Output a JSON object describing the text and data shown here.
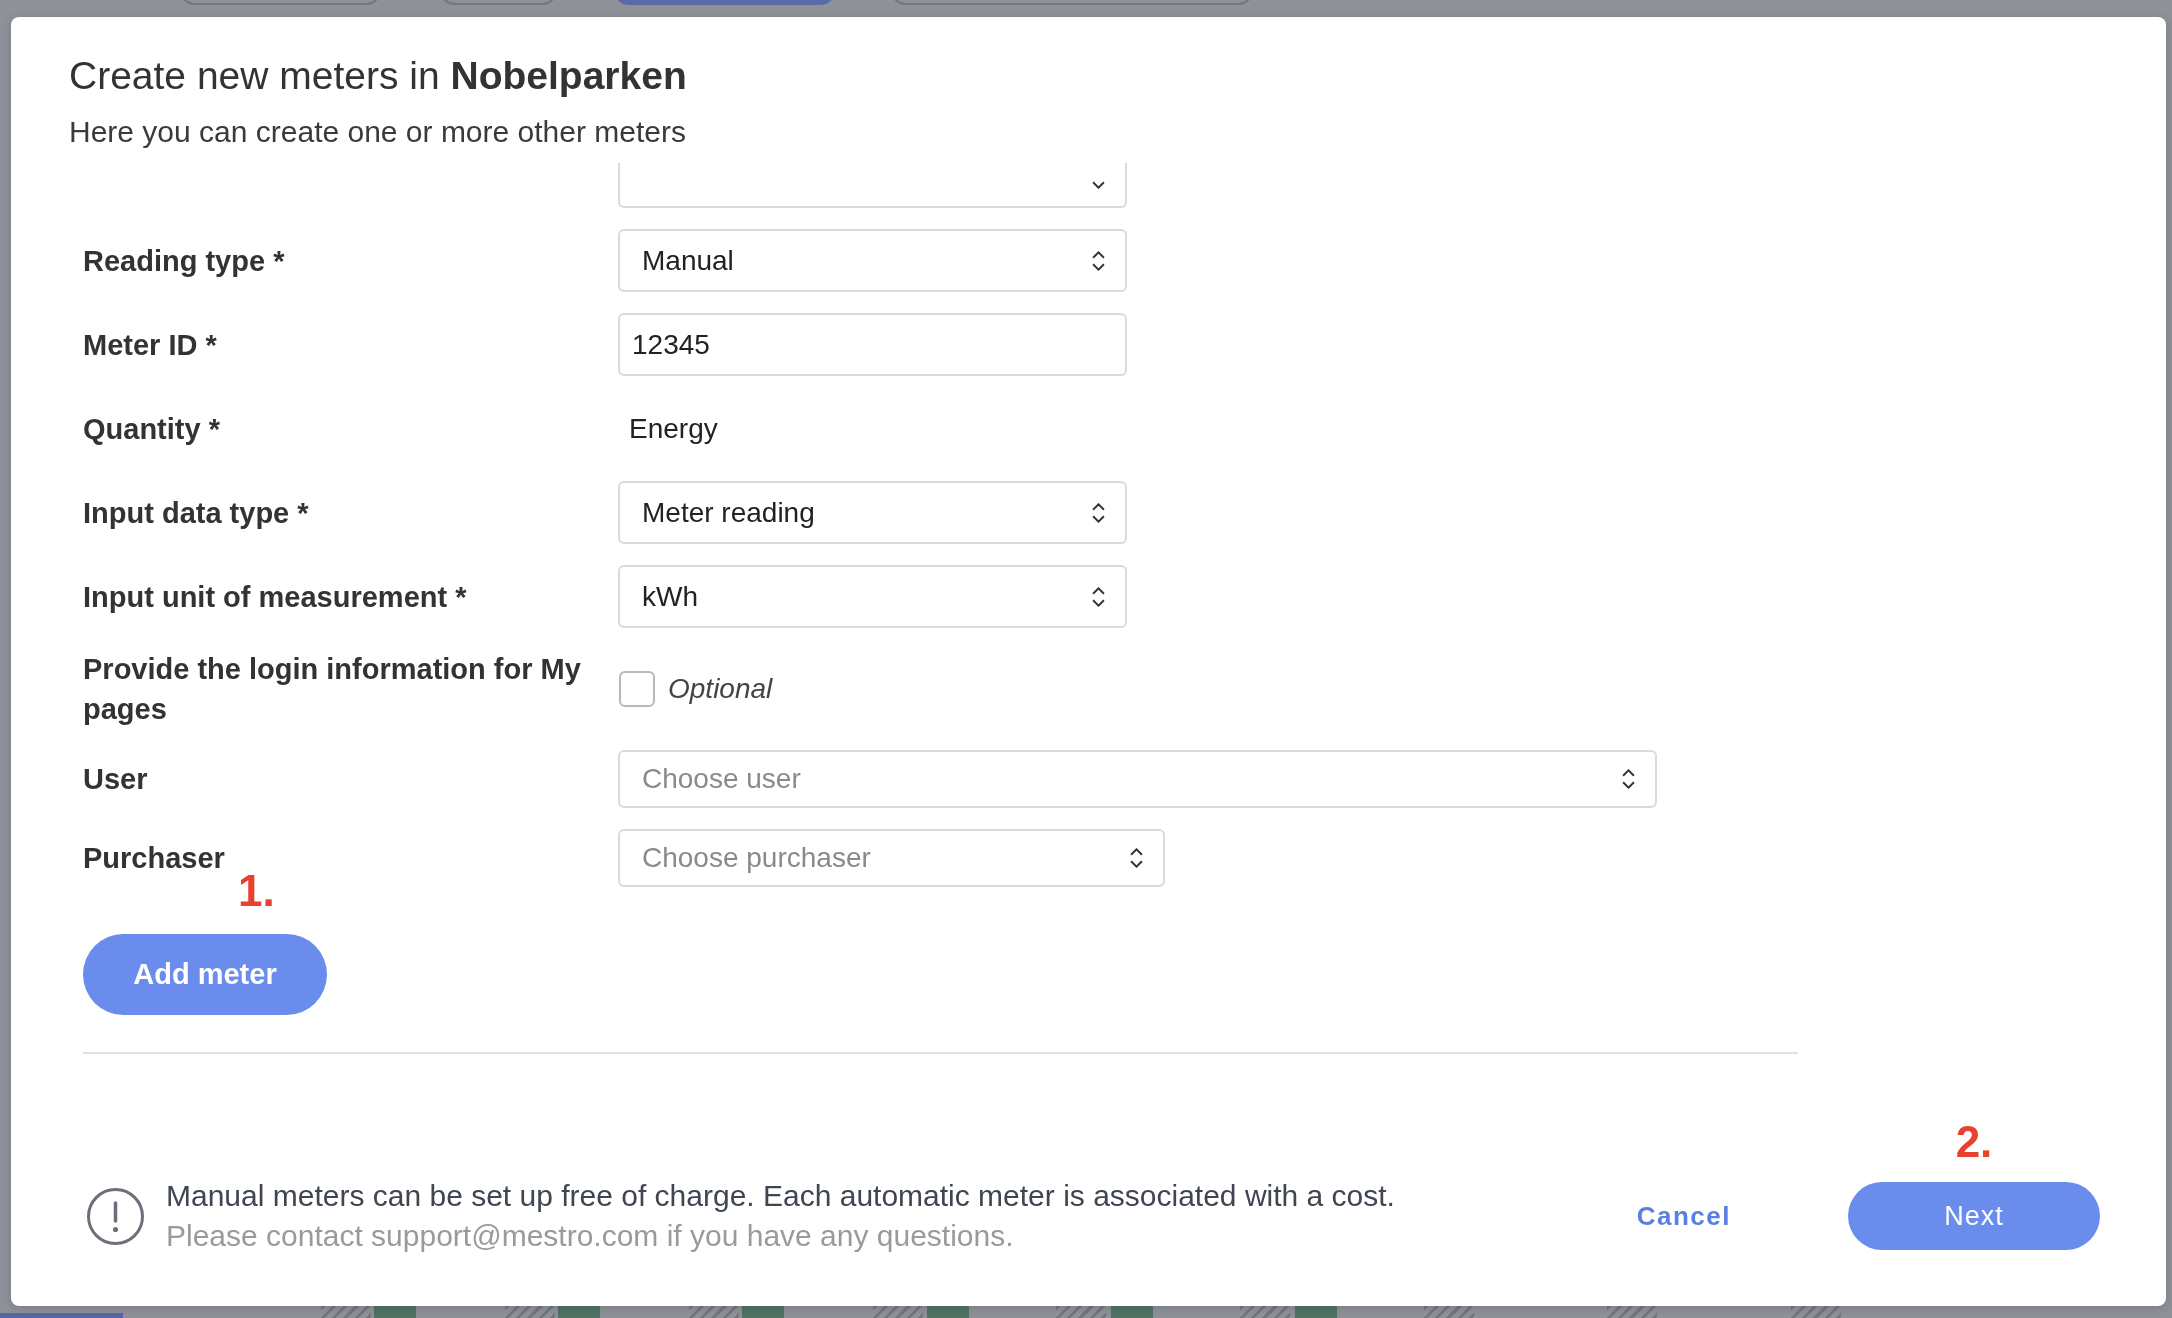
{
  "dialog": {
    "title": "Create new meters in **Nobelparken**",
    "subtitle": "Here you can create one or more other meters"
  },
  "form": {
    "fields": [
      {
        "kind": "partial"
      },
      {
        "kind": "select",
        "label": "Reading type *",
        "value": "Manual"
      },
      {
        "kind": "input",
        "label": "Meter ID *",
        "value": "12345"
      },
      {
        "kind": "static",
        "label": "Quantity *",
        "value": "Energy"
      },
      {
        "kind": "select",
        "label": "Input data type *",
        "value": "Meter reading"
      },
      {
        "kind": "select",
        "label": "Input unit of measurement *",
        "value": "kWh"
      },
      {
        "kind": "checkbox",
        "label": "Provide the login information for My pages",
        "option": "Optional",
        "checked": false
      },
      {
        "kind": "select",
        "label": "User",
        "placeholder": "Choose user"
      },
      {
        "kind": "select",
        "label": "Purchaser",
        "placeholder": "Choose purchaser"
      }
    ],
    "add_button": {
      "label": "Add meter",
      "annotation": "1."
    }
  },
  "footer": {
    "notice": "Manual meters can be set up free of charge. Each automatic meter is associated with a cost.",
    "contact": "Please contact support@mestro.com if you have any questions.",
    "cancel": "Cancel",
    "next": {
      "label": "Next",
      "annotation": "2."
    }
  }
}
